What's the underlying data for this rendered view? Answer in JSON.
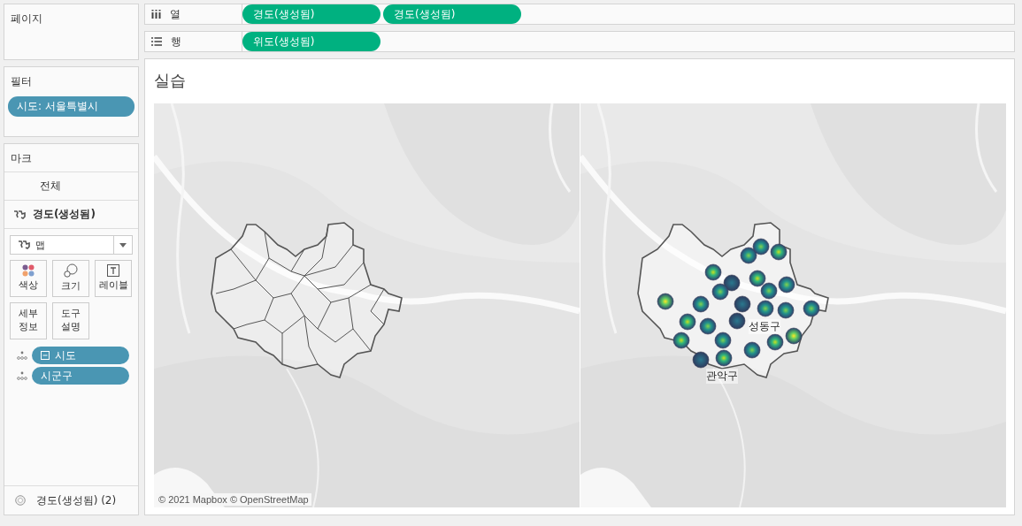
{
  "pages": {
    "title": "페이지"
  },
  "filters": {
    "title": "필터",
    "pills": [
      {
        "label": "시도: 서울특별시"
      }
    ]
  },
  "marks": {
    "title": "마크",
    "layers": [
      {
        "label": "전체",
        "selected": false,
        "icon": false
      },
      {
        "label": "경도(생성됨)",
        "selected": true,
        "icon": true
      }
    ],
    "mark_type": "맵",
    "buttons": [
      {
        "label": "색상",
        "kind": "color"
      },
      {
        "label": "크기",
        "kind": "size"
      },
      {
        "label": "레이블",
        "kind": "label"
      },
      {
        "label": "세부 정보",
        "kind": "detail"
      },
      {
        "label": "도구 설명",
        "kind": "tooltip"
      }
    ],
    "fields": [
      {
        "label": "시도",
        "hierarchy": true
      },
      {
        "label": "시군구",
        "hierarchy": false
      }
    ],
    "legend": "경도(생성됨) (2)"
  },
  "shelves": [
    {
      "label": "열",
      "kind": "columns",
      "pills": [
        "경도(생성됨)",
        "경도(생성됨)"
      ]
    },
    {
      "label": "행",
      "kind": "rows",
      "pills": [
        "위도(생성됨)"
      ]
    }
  ],
  "view": {
    "title": "실습",
    "mark_labels": [
      "성동구",
      "관악구"
    ],
    "attribution": "© 2021 Mapbox © OpenStreetMap"
  }
}
